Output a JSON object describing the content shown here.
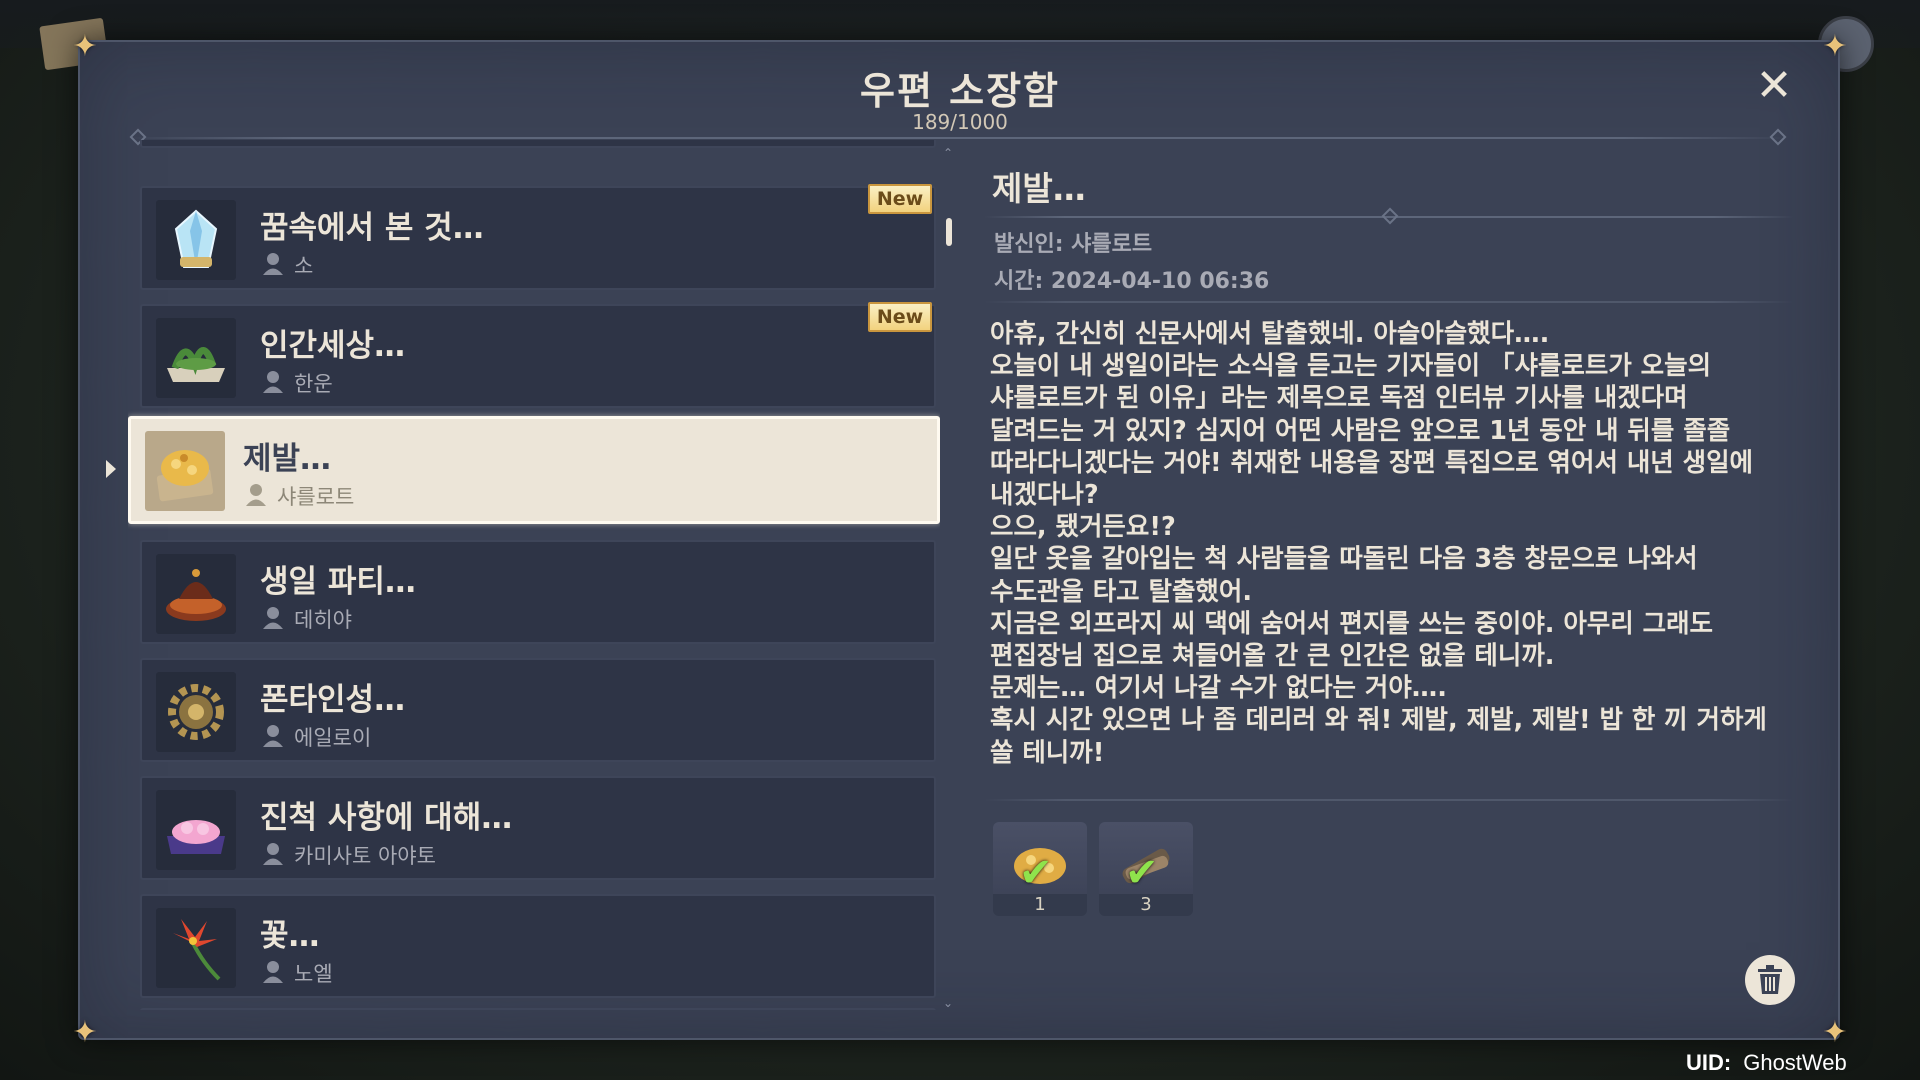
{
  "window": {
    "title": "우편 소장함",
    "count": "189/1000"
  },
  "mail_list": [
    {
      "title": "꿈속에서 본 것…",
      "sender": "소",
      "is_new": true,
      "new_label": "New",
      "selected": false
    },
    {
      "title": "인간세상…",
      "sender": "한운",
      "is_new": true,
      "new_label": "New",
      "selected": false
    },
    {
      "title": "제발…",
      "sender": "샤를로트",
      "is_new": false,
      "selected": true
    },
    {
      "title": "생일 파티…",
      "sender": "데히야",
      "is_new": false,
      "selected": false
    },
    {
      "title": "폰타인성…",
      "sender": "에일로이",
      "is_new": false,
      "selected": false
    },
    {
      "title": "진척 사항에 대해…",
      "sender": "카미사토 아야토",
      "is_new": false,
      "selected": false
    },
    {
      "title": "꽃…",
      "sender": "노엘",
      "is_new": false,
      "selected": false
    }
  ],
  "detail": {
    "title": "제발…",
    "sender_line": "발신인: 샤를로트",
    "time_line": "시간: 2024-04-10 06:36",
    "body_lines": [
      "아휴, 간신히 신문사에서 탈출했네. 아슬아슬했다….",
      "오늘이 내 생일이라는 소식을 듣고는 기자들이 「샤를로트가 오늘의",
      "샤를로트가 된 이유」라는 제목으로 독점 인터뷰 기사를 내겠다며",
      "달려드는 거 있지? 심지어 어떤 사람은 앞으로 1년 동안 내 뒤를 졸졸",
      "따라다니겠다는 거야! 취재한 내용을 장편 특집으로 엮어서 내년 생일에",
      "내겠다나?",
      "으으, 됐거든요!?",
      "일단 옷을 갈아입는 척 사람들을 따돌린 다음 3층 창문으로 나와서",
      "수도관을 타고 탈출했어.",
      "지금은 외프라지 씨 댁에 숨어서 편지를 쓰는 중이야. 아무리 그래도",
      "편집장님 집으로 쳐들어올 간 큰 인간은 없을 테니까.",
      "문제는… 여기서 나갈 수가 없다는 거야….",
      "혹시 시간 있으면 나 좀 데리러 와 줘! 제발, 제발, 제발! 밥 한 끼 거하게",
      "쏠 테니까!"
    ],
    "rewards": [
      {
        "name": "cheese-dish",
        "qty": "1",
        "claimed": true
      },
      {
        "name": "scroll-items",
        "qty": "3",
        "claimed": true
      }
    ]
  },
  "uid": {
    "label": "UID:",
    "value": "GhostWeb"
  },
  "colors": {
    "panel": "#3b4255",
    "item": "#2e3446",
    "selected": "#ece5d8",
    "text": "#ece5d8",
    "new_badge": "#f2d27e",
    "check": "#8fe34c"
  }
}
